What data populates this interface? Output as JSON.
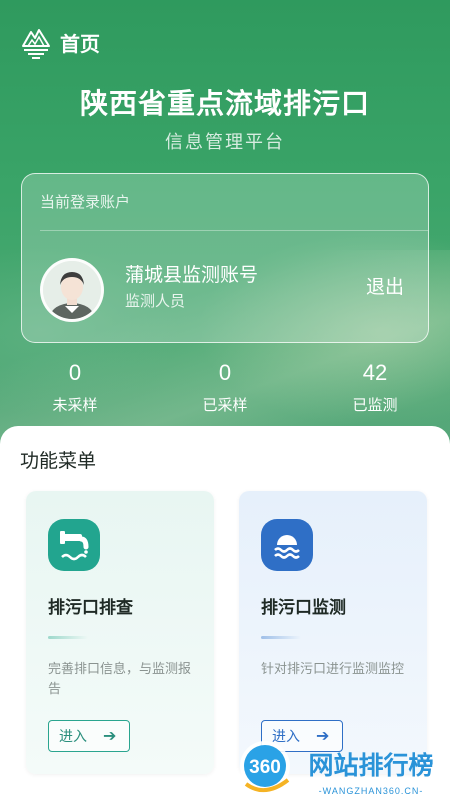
{
  "header": {
    "title": "首页"
  },
  "hero": {
    "title": "陕西省重点流域排污口",
    "subtitle": "信息管理平台"
  },
  "account": {
    "label": "当前登录账户",
    "name": "蒲城县监测账号",
    "role": "监测人员",
    "logout_label": "退出"
  },
  "stats": [
    {
      "value": "0",
      "label": "未采样"
    },
    {
      "value": "0",
      "label": "已采样"
    },
    {
      "value": "42",
      "label": "已监测"
    }
  ],
  "menu": {
    "title": "功能菜单",
    "cards": [
      {
        "title": "排污口排查",
        "description": "完善排口信息，与监测报告",
        "button_label": "进入",
        "icon": "outfall-pipe-icon",
        "accent": "#22a58f"
      },
      {
        "title": "排污口监测",
        "description": "针对排污口进行监测监控",
        "button_label": "进入",
        "icon": "water-monitor-icon",
        "accent": "#2f6fc6"
      }
    ]
  },
  "watermark": {
    "badge": "360",
    "name": "网站排行榜",
    "domain": "-WANGZHAN360.CN-"
  }
}
